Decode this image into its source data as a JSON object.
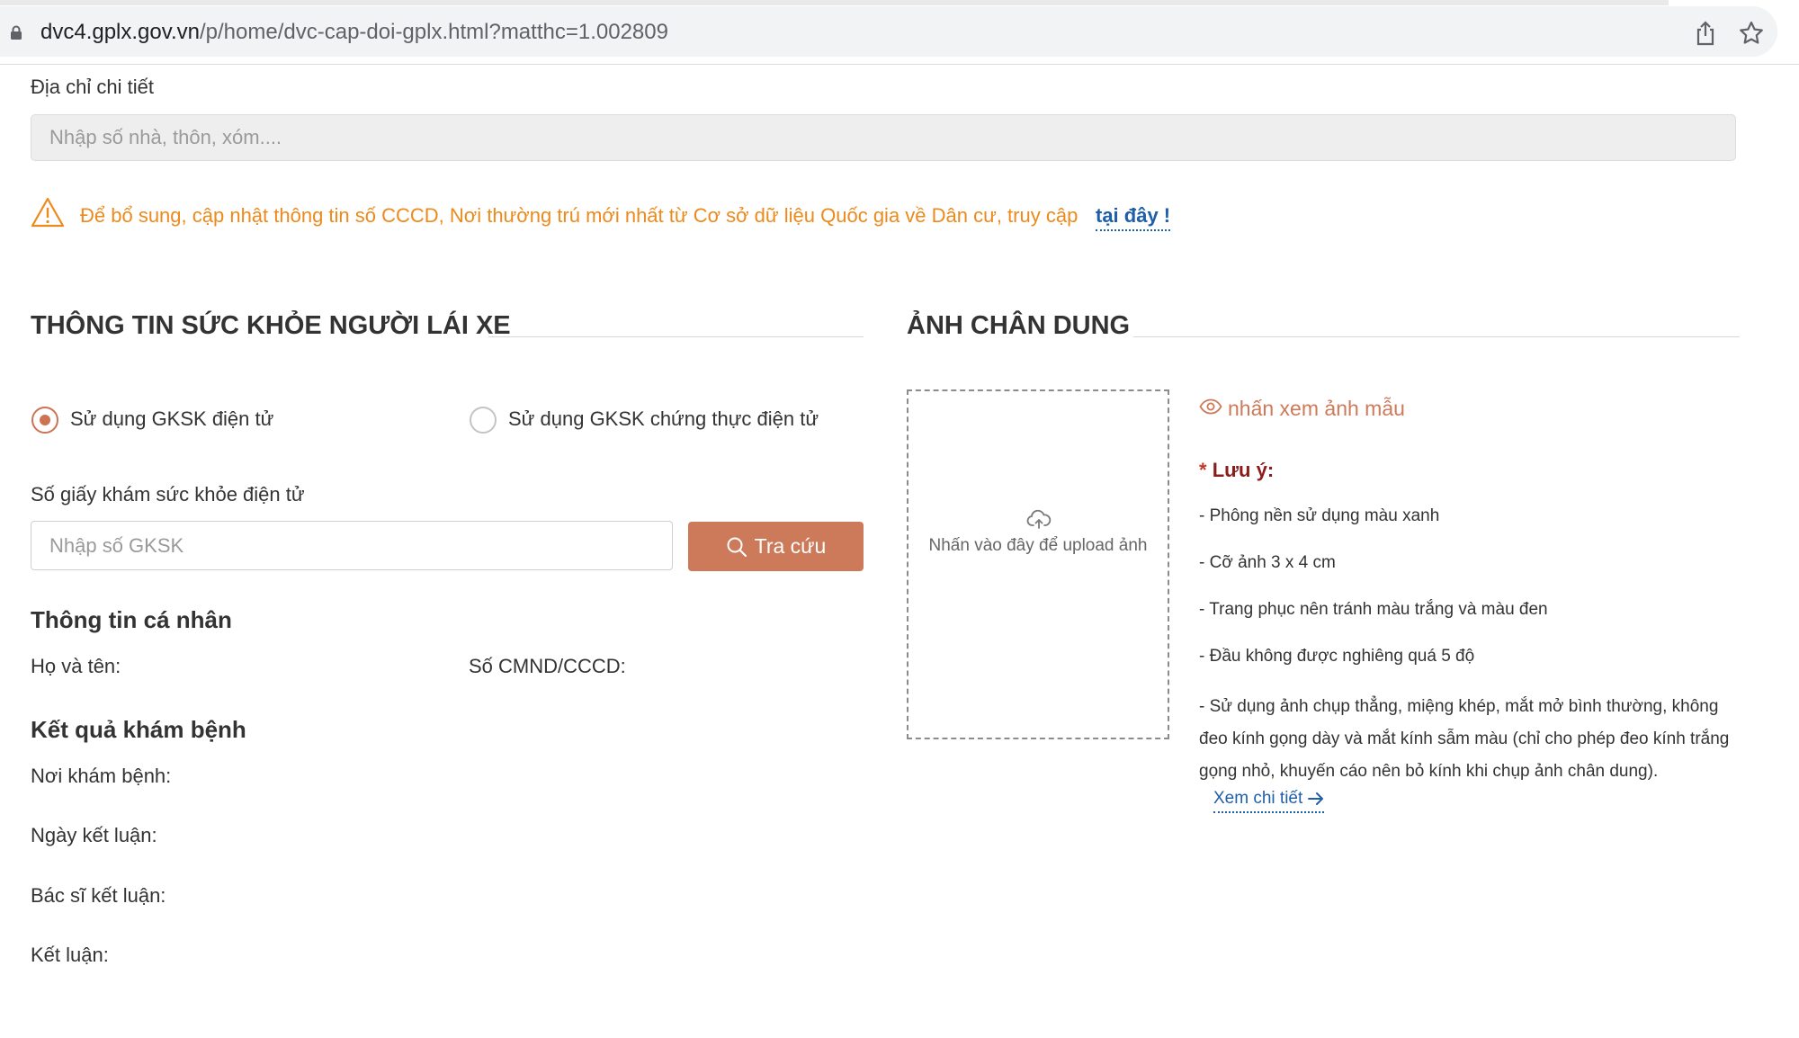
{
  "browser": {
    "url_host": "dvc4.gplx.gov.vn",
    "url_path": "/p/home/dvc-cap-doi-gplx.html?matthc=1.002809",
    "icons": [
      "lock-icon",
      "share-icon",
      "star-icon"
    ]
  },
  "address": {
    "label": "Địa chỉ chi tiết",
    "placeholder": "Nhập số nhà, thôn, xóm....",
    "value": ""
  },
  "warning": {
    "icon": "warning-triangle-icon",
    "text": "Để bổ sung, cập nhật thông tin số CCCD, Nơi thường trú mới nhất từ Cơ sở dữ liệu Quốc gia về Dân cư, truy cập",
    "link": "tại đây !"
  },
  "health": {
    "title": "THÔNG TIN SỨC KHỎE NGƯỜI LÁI XE",
    "radio_options": [
      {
        "label": "Sử dụng GKSK điện tử",
        "checked": true
      },
      {
        "label": "Sử dụng GKSK chứng thực điện tử",
        "checked": false
      }
    ],
    "gksk_label": "Số giấy khám sức khỏe điện tử",
    "gksk_placeholder": "Nhập số GKSK",
    "gksk_value": "",
    "lookup_button": "Tra cứu"
  },
  "personal": {
    "heading": "Thông tin cá nhân",
    "fullname_label": "Họ và tên:",
    "idcard_label": "Số CMND/CCCD:"
  },
  "results": {
    "heading": "Kết quả khám bệnh",
    "clinic_label": "Nơi khám bệnh:",
    "date_label": "Ngày kết luận:",
    "doctor_label": "Bác sĩ kết luận:",
    "conclusion_label": "Kết luận:"
  },
  "portrait": {
    "title": "ẢNH CHÂN DUNG",
    "upload_text": "Nhấn vào đây để upload ảnh",
    "sample_link": "nhấn xem ảnh mẫu",
    "note_star": "*",
    "note_title": "Lưu ý:",
    "notes": [
      "- Phông nền sử dụng màu xanh",
      "- Cỡ ảnh 3 x 4 cm",
      "- Trang phục nên tránh màu trắng và màu đen",
      "- Đầu không được nghiêng quá 5 độ",
      "- Sử dụng ảnh chụp thẳng, miệng khép, mắt mở bình thường, không đeo kính gọng dày và mắt kính sẫm màu (chỉ cho phép đeo kính trắng gọng nhỏ, khuyến cáo nên bỏ kính khi chụp ảnh chân dung)."
    ],
    "detail_link": "Xem chi tiết"
  },
  "colors": {
    "accent": "#cd7a5a",
    "warning": "#ec8a1c",
    "link": "#1f5fa8",
    "note_title": "#8a1c1c"
  }
}
